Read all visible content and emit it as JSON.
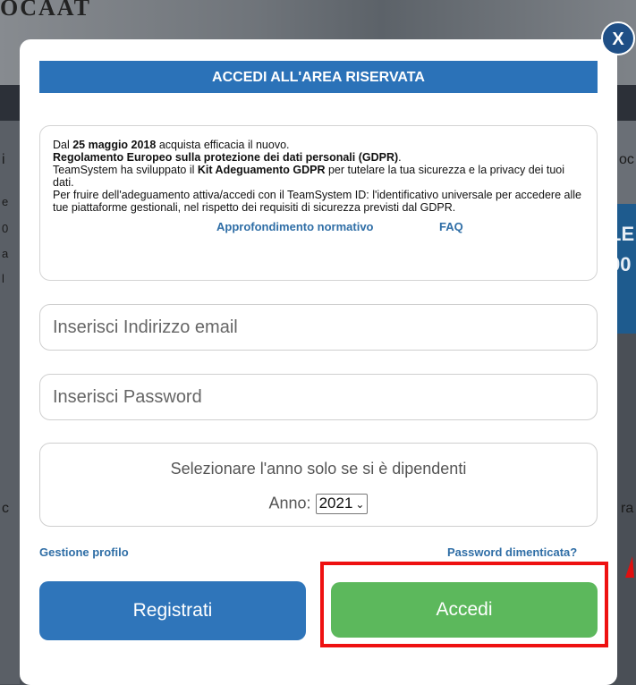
{
  "background": {
    "top_text": "OCAAT",
    "fragments": [
      "i",
      "e",
      "0",
      "a",
      "l",
      "c",
      "oc",
      "ra"
    ],
    "right_text": [
      "LE",
      "00"
    ]
  },
  "modal": {
    "close_label": "X",
    "title": "ACCEDI ALL'AREA RISERVATA",
    "info": {
      "line1_pre": "Dal ",
      "line1_bold": "25 maggio 2018",
      "line1_post": " acquista efficacia il nuovo.",
      "line2_bold": "Regolamento Europeo sulla protezione dei dati personali (GDPR)",
      "line2_post": ".",
      "line3_pre": "TeamSystem ha sviluppato il ",
      "line3_bold": "Kit Adeguamento GDPR",
      "line3_post": " per tutelare la tua sicurezza e la privacy dei tuoi dati.",
      "line4": "Per fruire dell'adeguamento attiva/accedi con il TeamSystem ID: l'identificativo universale per accedere alle tue piattaforme gestionali, nel rispetto dei requisiti di sicurezza previsti dal GDPR.",
      "link_normativo": "Approfondimento normativo",
      "link_faq": "FAQ"
    },
    "email": {
      "placeholder": "Inserisci Indirizzo email",
      "value": ""
    },
    "password": {
      "placeholder": "Inserisci Password",
      "value": ""
    },
    "year": {
      "label": "Selezionare l'anno solo se si è dipendenti",
      "anno_label": "Anno:",
      "selected": "2021"
    },
    "link_profile": "Gestione profilo",
    "link_forgot": "Password dimenticata?",
    "register_button": "Registrati",
    "login_button": "Accedi",
    "highlight_color": "#ee1111"
  }
}
